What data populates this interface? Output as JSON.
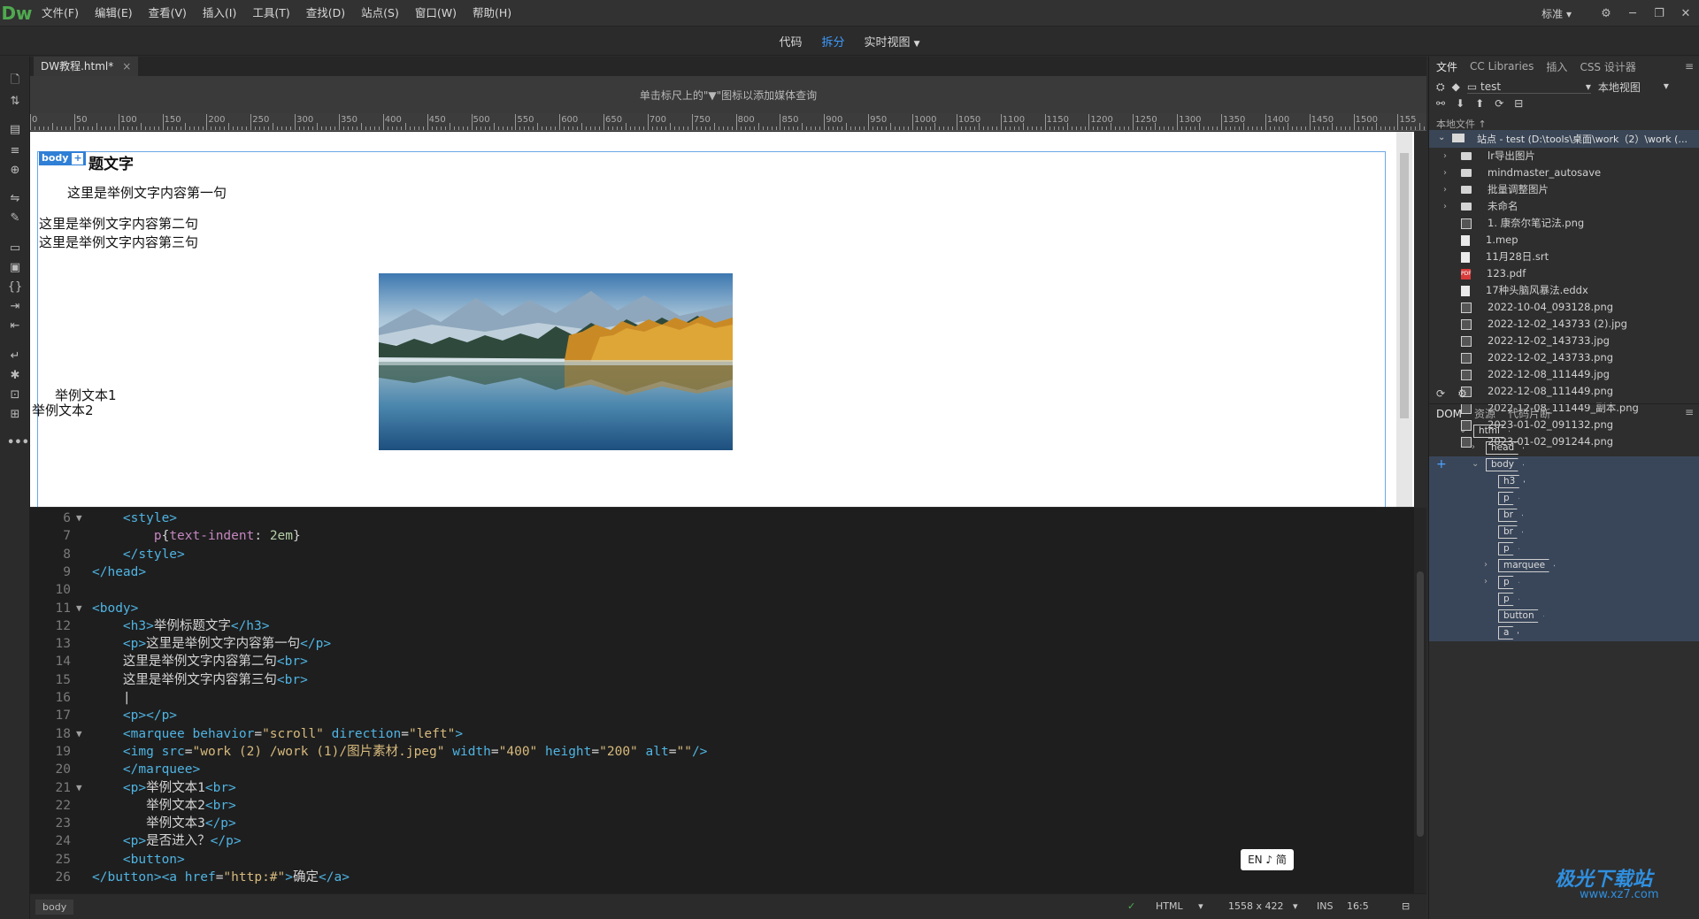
{
  "app": {
    "logo": "Dw"
  },
  "menu": [
    "文件(F)",
    "编辑(E)",
    "查看(V)",
    "插入(I)",
    "工具(T)",
    "查找(D)",
    "站点(S)",
    "窗口(W)",
    "帮助(H)"
  ],
  "workspace": "标准",
  "views": {
    "code": "代码",
    "split": "拆分",
    "live": "实时视图"
  },
  "document": {
    "tab": "DW教程.html*",
    "mq_hint": "单击标尺上的\"▼\"图标以添加媒体查询"
  },
  "ruler": [
    "0",
    "50",
    "100",
    "150",
    "200",
    "250",
    "300",
    "350",
    "400",
    "450",
    "500",
    "550",
    "600",
    "650",
    "700",
    "750",
    "800",
    "850",
    "900",
    "950",
    "1000",
    "1050",
    "1100",
    "1150",
    "1200",
    "1250",
    "1300",
    "1350",
    "1400",
    "1450",
    "1500",
    "155"
  ],
  "design": {
    "body_tag": "body",
    "plus": "+",
    "h3": "题文字",
    "p1": "这里是举例文字内容第一句",
    "line2": "这里是举例文字内容第二句",
    "line3": "这里是举例文字内容第三句",
    "t1": "举例文本1",
    "t2": "举例文本2"
  },
  "code_lines": [
    {
      "n": "6",
      "fold": true,
      "html": "    <span class='tag'>&lt;style&gt;</span>"
    },
    {
      "n": "7",
      "fold": false,
      "html": "        <span class='prop'>p</span>{<span class='prop'>text-indent</span>: <span class='css'>2em</span>}"
    },
    {
      "n": "8",
      "fold": false,
      "html": "    <span class='tag'>&lt;/style&gt;</span>"
    },
    {
      "n": "9",
      "fold": false,
      "html": "<span class='tag'>&lt;/head&gt;</span>"
    },
    {
      "n": "10",
      "fold": false,
      "html": ""
    },
    {
      "n": "11",
      "fold": true,
      "html": "<span class='tag'>&lt;body&gt;</span>"
    },
    {
      "n": "12",
      "fold": false,
      "html": "    <span class='tag'>&lt;h3&gt;</span>举例标题文字<span class='tag'>&lt;/h3&gt;</span>"
    },
    {
      "n": "13",
      "fold": false,
      "html": "    <span class='tag'>&lt;p&gt;</span>这里是举例文字内容第一句<span class='tag'>&lt;/p&gt;</span>"
    },
    {
      "n": "14",
      "fold": false,
      "html": "    这里是举例文字内容第二句<span class='tag'>&lt;br&gt;</span>"
    },
    {
      "n": "15",
      "fold": false,
      "html": "    这里是举例文字内容第三句<span class='tag'>&lt;br&gt;</span>"
    },
    {
      "n": "16",
      "fold": false,
      "html": "    |"
    },
    {
      "n": "17",
      "fold": false,
      "html": "    <span class='tag'>&lt;p&gt;&lt;/p&gt;</span>"
    },
    {
      "n": "18",
      "fold": true,
      "html": "    <span class='tag'>&lt;marquee</span> <span class='attr'>behavior</span>=<span class='str'>\"scroll\"</span> <span class='attr'>direction</span>=<span class='str'>\"left\"</span><span class='tag'>&gt;</span>"
    },
    {
      "n": "19",
      "fold": false,
      "html": "    <span class='tag'>&lt;img</span> <span class='attr'>src</span>=<span class='str'>\"work (2) /work (1)/图片素材.jpeg\"</span> <span class='attr'>width</span>=<span class='str'>\"400\"</span> <span class='attr'>height</span>=<span class='str'>\"200\"</span> <span class='attr'>alt</span>=<span class='str'>\"\"</span><span class='tag'>/&gt;</span>"
    },
    {
      "n": "20",
      "fold": false,
      "html": "    <span class='tag'>&lt;/marquee&gt;</span>"
    },
    {
      "n": "21",
      "fold": true,
      "html": "    <span class='tag'>&lt;p&gt;</span>举例文本1<span class='tag'>&lt;br&gt;</span>"
    },
    {
      "n": "22",
      "fold": false,
      "html": "       举例文本2<span class='tag'>&lt;br&gt;</span>"
    },
    {
      "n": "23",
      "fold": false,
      "html": "       举例文本3<span class='tag'>&lt;/p&gt;</span>"
    },
    {
      "n": "24",
      "fold": false,
      "html": "    <span class='tag'>&lt;p&gt;</span>是否进入？<span class='tag'>&lt;/p&gt;</span>"
    },
    {
      "n": "25",
      "fold": false,
      "html": "    <span class='tag'>&lt;button&gt;</span>"
    },
    {
      "n": "26",
      "fold": false,
      "html": "<span class='tag'>&lt;/button&gt;&lt;a</span> <span class='attr'>href</span>=<span class='str'>\"http:#\"</span><span class='tag'>&gt;</span>确定<span class='tag'>&lt;/a&gt;</span>"
    }
  ],
  "ime": "EN ♪ 简",
  "status": {
    "crumb": "body",
    "lang": "HTML",
    "size": "1558 x 422",
    "mode": "INS",
    "pos": "16:5"
  },
  "files_panel": {
    "tabs": [
      "文件",
      "CC Libraries",
      "插入",
      "CSS 设计器"
    ],
    "site": "test",
    "view": "本地视图",
    "local_label": "本地文件 ↑",
    "root": "站点 - test (D:\\tools\\桌面\\work（2）\\work (...",
    "items": [
      {
        "type": "folder",
        "name": "lr导出图片"
      },
      {
        "type": "folder",
        "name": "mindmaster_autosave"
      },
      {
        "type": "folder",
        "name": "批量调整图片"
      },
      {
        "type": "folder",
        "name": "未命名"
      },
      {
        "type": "img",
        "name": "1. 康奈尔笔记法.png"
      },
      {
        "type": "doc",
        "name": "1.mep"
      },
      {
        "type": "doc",
        "name": "11月28日.srt"
      },
      {
        "type": "pdf",
        "name": "123.pdf"
      },
      {
        "type": "doc",
        "name": "17种头脑风暴法.eddx"
      },
      {
        "type": "img",
        "name": "2022-10-04_093128.png"
      },
      {
        "type": "img",
        "name": "2022-12-02_143733 (2).jpg"
      },
      {
        "type": "img",
        "name": "2022-12-02_143733.jpg"
      },
      {
        "type": "img",
        "name": "2022-12-02_143733.png"
      },
      {
        "type": "img",
        "name": "2022-12-08_111449.jpg"
      },
      {
        "type": "img",
        "name": "2022-12-08_111449.png"
      },
      {
        "type": "img",
        "name": "2022-12-08_111449_副本.png"
      },
      {
        "type": "img",
        "name": "2023-01-02_091132.png"
      },
      {
        "type": "img",
        "name": "2023-01-02_091244.png"
      }
    ]
  },
  "dom_panel": {
    "tabs": [
      "DOM",
      "资源",
      "代码片断"
    ],
    "nodes": [
      {
        "tag": "html",
        "depth": 0,
        "expand": "open",
        "sel": false
      },
      {
        "tag": "head",
        "depth": 1,
        "expand": "closed",
        "sel": false
      },
      {
        "tag": "body",
        "depth": 1,
        "expand": "open",
        "sel": true
      },
      {
        "tag": "h3",
        "depth": 2,
        "expand": "",
        "sel": true
      },
      {
        "tag": "p",
        "depth": 2,
        "expand": "",
        "sel": true
      },
      {
        "tag": "br",
        "depth": 2,
        "expand": "",
        "sel": true
      },
      {
        "tag": "br",
        "depth": 2,
        "expand": "",
        "sel": true
      },
      {
        "tag": "p",
        "depth": 2,
        "expand": "",
        "sel": true
      },
      {
        "tag": "marquee",
        "depth": 2,
        "expand": "closed",
        "sel": true
      },
      {
        "tag": "p",
        "depth": 2,
        "expand": "closed",
        "sel": true
      },
      {
        "tag": "p",
        "depth": 2,
        "expand": "",
        "sel": true
      },
      {
        "tag": "button",
        "depth": 2,
        "expand": "",
        "sel": true
      },
      {
        "tag": "a",
        "depth": 2,
        "expand": "",
        "sel": true
      }
    ]
  },
  "watermark": {
    "cn": "极光下载站",
    "url": "www.xz7.com"
  }
}
